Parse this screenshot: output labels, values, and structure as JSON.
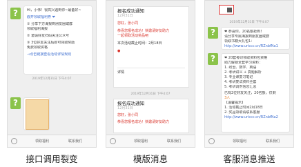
{
  "panels": {
    "left": {
      "caption": "接口调用裂变",
      "bubble_lines": [
        "Hi，小伟！很高兴遇到你~最备好~",
        "戳开领取福利券 ❤",
        "① 分享下方海报到朋友圈或群",
        "领取福利海报",
        "② 邀请好友扫码关注公众号",
        "③ 3位好友关注后即可领取奖励",
        "免费领取资格",
        "→点击链接查看活动详情规则"
      ],
      "timestamp": "2019年12月31日 下午4:07",
      "bottom": {
        "menu1": "领取福利",
        "menu2": "联系我们"
      }
    },
    "middle": {
      "caption": "模版消息",
      "card1": {
        "title": "报名成功通知",
        "date": "12月31日",
        "greet": "您好，张小同",
        "body1": "恭喜您报名成功！快邀请好友助力",
        "body2": "一起领取活动奖品吧",
        "body3": "本次活动截止时间：2月18日",
        "footer": "详情"
      },
      "card2": {
        "title": "报名成功通知",
        "date": "12月31日",
        "greet": "您好，张小同",
        "body1": "恭喜您报名成功！快邀请好友助力"
      },
      "timestamp": "2019年12月31日 下午4:07",
      "bottom": {
        "menu1": "领取福利",
        "menu2": "联系我们"
      }
    },
    "right": {
      "caption": "客服消息推送",
      "bubble1": [
        "❤ 恭喜你，20名额抢到！",
        "请分享专属海报到朋友圈或群",
        "领取书籍大礼包1：",
        "http://www.uriccc.cn/RZnbfNa1"
      ],
      "bubble2": [
        "❤ 20套考研领取资料包资格",
        "助力解锁全套学习资料：",
        "1. 政治、数学、英语",
        "2. 考研讲义 + 真题解析",
        "3. 专业课复习笔记",
        "4. 考研复试资料全套",
        "5. 考研调剂信息汇总",
        "已有2位好友关注，20名额，仅剩",
        "3人",
        "",
        "【温馨提示】",
        "1. 活动截止时间2月18日",
        "2. 奖品领取请联系客服",
        "http://www.uriccc.cn/RZnbfNa2"
      ],
      "timestamp": "2019年12月31日 下午4:07",
      "bottom": {
        "menu1": "领取福利",
        "menu2": "联系我们"
      }
    }
  }
}
